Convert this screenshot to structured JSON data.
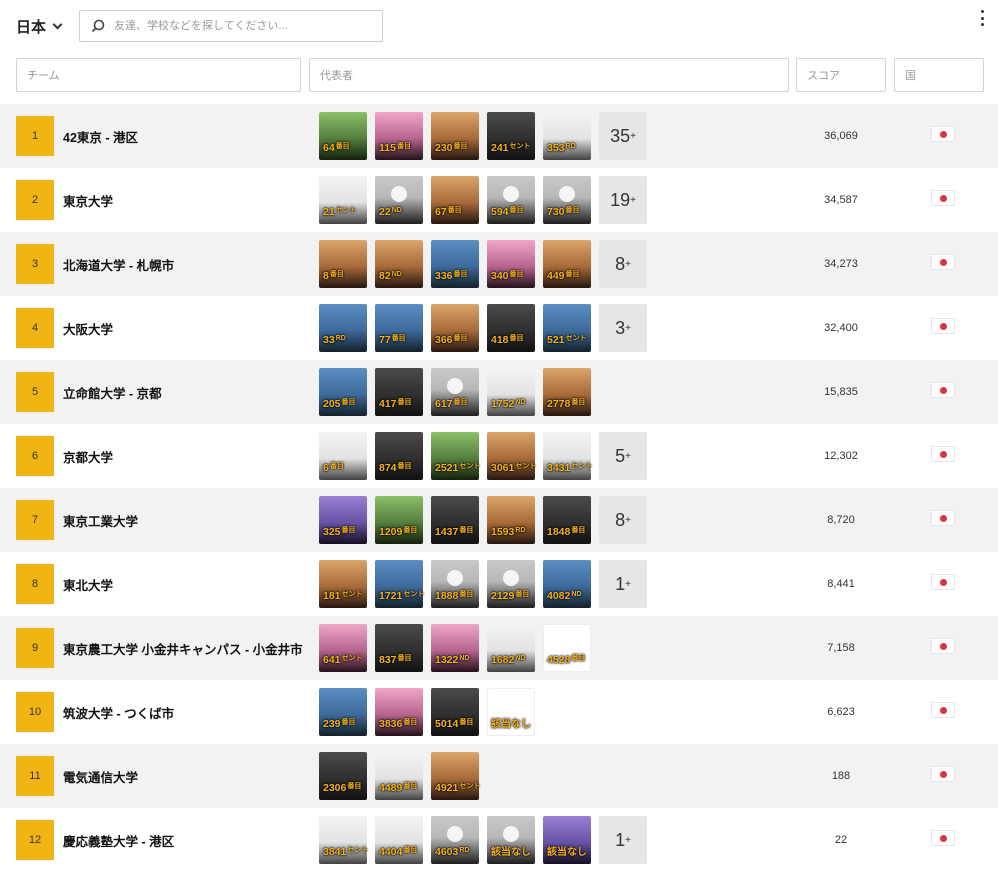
{
  "header": {
    "region_label": "日本",
    "search_placeholder": "友達、学校などを探してください..."
  },
  "filters": {
    "team": "チーム",
    "representative": "代表者",
    "score": "スコア",
    "country": "国"
  },
  "colors": {
    "rank_badge": "#f0b512",
    "rep_rank_text": "#f3b223",
    "flag_circle": "#d9363e"
  },
  "rows": [
    {
      "rank": "1",
      "team": "42東京 - 港区",
      "score": "36,069",
      "more": "35",
      "reps": [
        {
          "n": "64",
          "s": "番目",
          "c": "green"
        },
        {
          "n": "115",
          "s": "番目",
          "c": "pink"
        },
        {
          "n": "230",
          "s": "番目",
          "c": "warm"
        },
        {
          "n": "241",
          "s": "セント",
          "c": "dark"
        },
        {
          "n": "353",
          "s": "RD",
          "c": "white"
        }
      ]
    },
    {
      "rank": "2",
      "team": "東京大学",
      "score": "34,587",
      "more": "19",
      "reps": [
        {
          "n": "21",
          "s": "セント",
          "c": "white"
        },
        {
          "n": "22",
          "s": "ND",
          "c": "gray"
        },
        {
          "n": "67",
          "s": "番目",
          "c": "warm"
        },
        {
          "n": "594",
          "s": "番目",
          "c": "gray"
        },
        {
          "n": "730",
          "s": "番目",
          "c": "gray"
        }
      ]
    },
    {
      "rank": "3",
      "team": "北海道大学 - 札幌市",
      "score": "34,273",
      "more": "8",
      "reps": [
        {
          "n": "8",
          "s": "番目",
          "c": "warm"
        },
        {
          "n": "82",
          "s": "ND",
          "c": "warm"
        },
        {
          "n": "336",
          "s": "番目",
          "c": "blue"
        },
        {
          "n": "340",
          "s": "番目",
          "c": "pink"
        },
        {
          "n": "449",
          "s": "番目",
          "c": "warm"
        }
      ]
    },
    {
      "rank": "4",
      "team": "大阪大学",
      "score": "32,400",
      "more": "3",
      "reps": [
        {
          "n": "33",
          "s": "RD",
          "c": "blue"
        },
        {
          "n": "77",
          "s": "番目",
          "c": "blue"
        },
        {
          "n": "366",
          "s": "番目",
          "c": "warm"
        },
        {
          "n": "418",
          "s": "番目",
          "c": "dark"
        },
        {
          "n": "521",
          "s": "セント",
          "c": "blue"
        }
      ]
    },
    {
      "rank": "5",
      "team": "立命館大学 - 京都",
      "score": "15,835",
      "more": "",
      "reps": [
        {
          "n": "205",
          "s": "番目",
          "c": "blue"
        },
        {
          "n": "417",
          "s": "番目",
          "c": "dark"
        },
        {
          "n": "617",
          "s": "番目",
          "c": "gray"
        },
        {
          "n": "1752",
          "s": "ND",
          "c": "white"
        },
        {
          "n": "2778",
          "s": "番目",
          "c": "warm"
        }
      ]
    },
    {
      "rank": "6",
      "team": "京都大学",
      "score": "12,302",
      "more": "5",
      "reps": [
        {
          "n": "6",
          "s": "番目",
          "c": "white"
        },
        {
          "n": "874",
          "s": "番目",
          "c": "dark"
        },
        {
          "n": "2521",
          "s": "セント",
          "c": "green"
        },
        {
          "n": "3061",
          "s": "セント",
          "c": "warm"
        },
        {
          "n": "3431",
          "s": "セント",
          "c": "white"
        }
      ]
    },
    {
      "rank": "7",
      "team": "東京工業大学",
      "score": "8,720",
      "more": "8",
      "reps": [
        {
          "n": "325",
          "s": "番目",
          "c": "purple"
        },
        {
          "n": "1209",
          "s": "番目",
          "c": "green"
        },
        {
          "n": "1437",
          "s": "番目",
          "c": "dark"
        },
        {
          "n": "1593",
          "s": "RD",
          "c": "warm"
        },
        {
          "n": "1848",
          "s": "番目",
          "c": "dark"
        }
      ]
    },
    {
      "rank": "8",
      "team": "東北大学",
      "score": "8,441",
      "more": "1",
      "reps": [
        {
          "n": "181",
          "s": "セント",
          "c": "warm"
        },
        {
          "n": "1721",
          "s": "セント",
          "c": "blue"
        },
        {
          "n": "1888",
          "s": "番目",
          "c": "gray"
        },
        {
          "n": "2129",
          "s": "番目",
          "c": "gray"
        },
        {
          "n": "4082",
          "s": "ND",
          "c": "blue"
        }
      ]
    },
    {
      "rank": "9",
      "team": "東京農工大学 小金井キャンパス - 小金井市",
      "score": "7,158",
      "more": "",
      "reps": [
        {
          "n": "641",
          "s": "セント",
          "c": "pink"
        },
        {
          "n": "837",
          "s": "番目",
          "c": "dark"
        },
        {
          "n": "1322",
          "s": "ND",
          "c": "pink"
        },
        {
          "n": "1682",
          "s": "ND",
          "c": "white"
        },
        {
          "n": "4528",
          "s": "番目",
          "c": "light"
        }
      ]
    },
    {
      "rank": "10",
      "team": "筑波大学 - つくば市",
      "score": "6,623",
      "more": "",
      "reps": [
        {
          "n": "239",
          "s": "番目",
          "c": "blue"
        },
        {
          "n": "3836",
          "s": "番目",
          "c": "pink"
        },
        {
          "n": "5014",
          "s": "番目",
          "c": "dark"
        },
        {
          "n": "",
          "s": "",
          "none": "該当なし",
          "c": "light"
        }
      ]
    },
    {
      "rank": "11",
      "team": "電気通信大学",
      "score": "188",
      "more": "",
      "reps": [
        {
          "n": "2306",
          "s": "番目",
          "c": "dark"
        },
        {
          "n": "4489",
          "s": "番目",
          "c": "white"
        },
        {
          "n": "4921",
          "s": "セント",
          "c": "warm"
        }
      ]
    },
    {
      "rank": "12",
      "team": "慶応義塾大学 - 港区",
      "score": "22",
      "more": "1",
      "reps": [
        {
          "n": "3841",
          "s": "セント",
          "c": "white"
        },
        {
          "n": "4404",
          "s": "番目",
          "c": "white"
        },
        {
          "n": "4603",
          "s": "RD",
          "c": "gray"
        },
        {
          "n": "",
          "s": "",
          "none": "該当なし",
          "c": "gray"
        },
        {
          "n": "",
          "s": "",
          "none": "該当なし",
          "c": "purple"
        }
      ]
    }
  ]
}
